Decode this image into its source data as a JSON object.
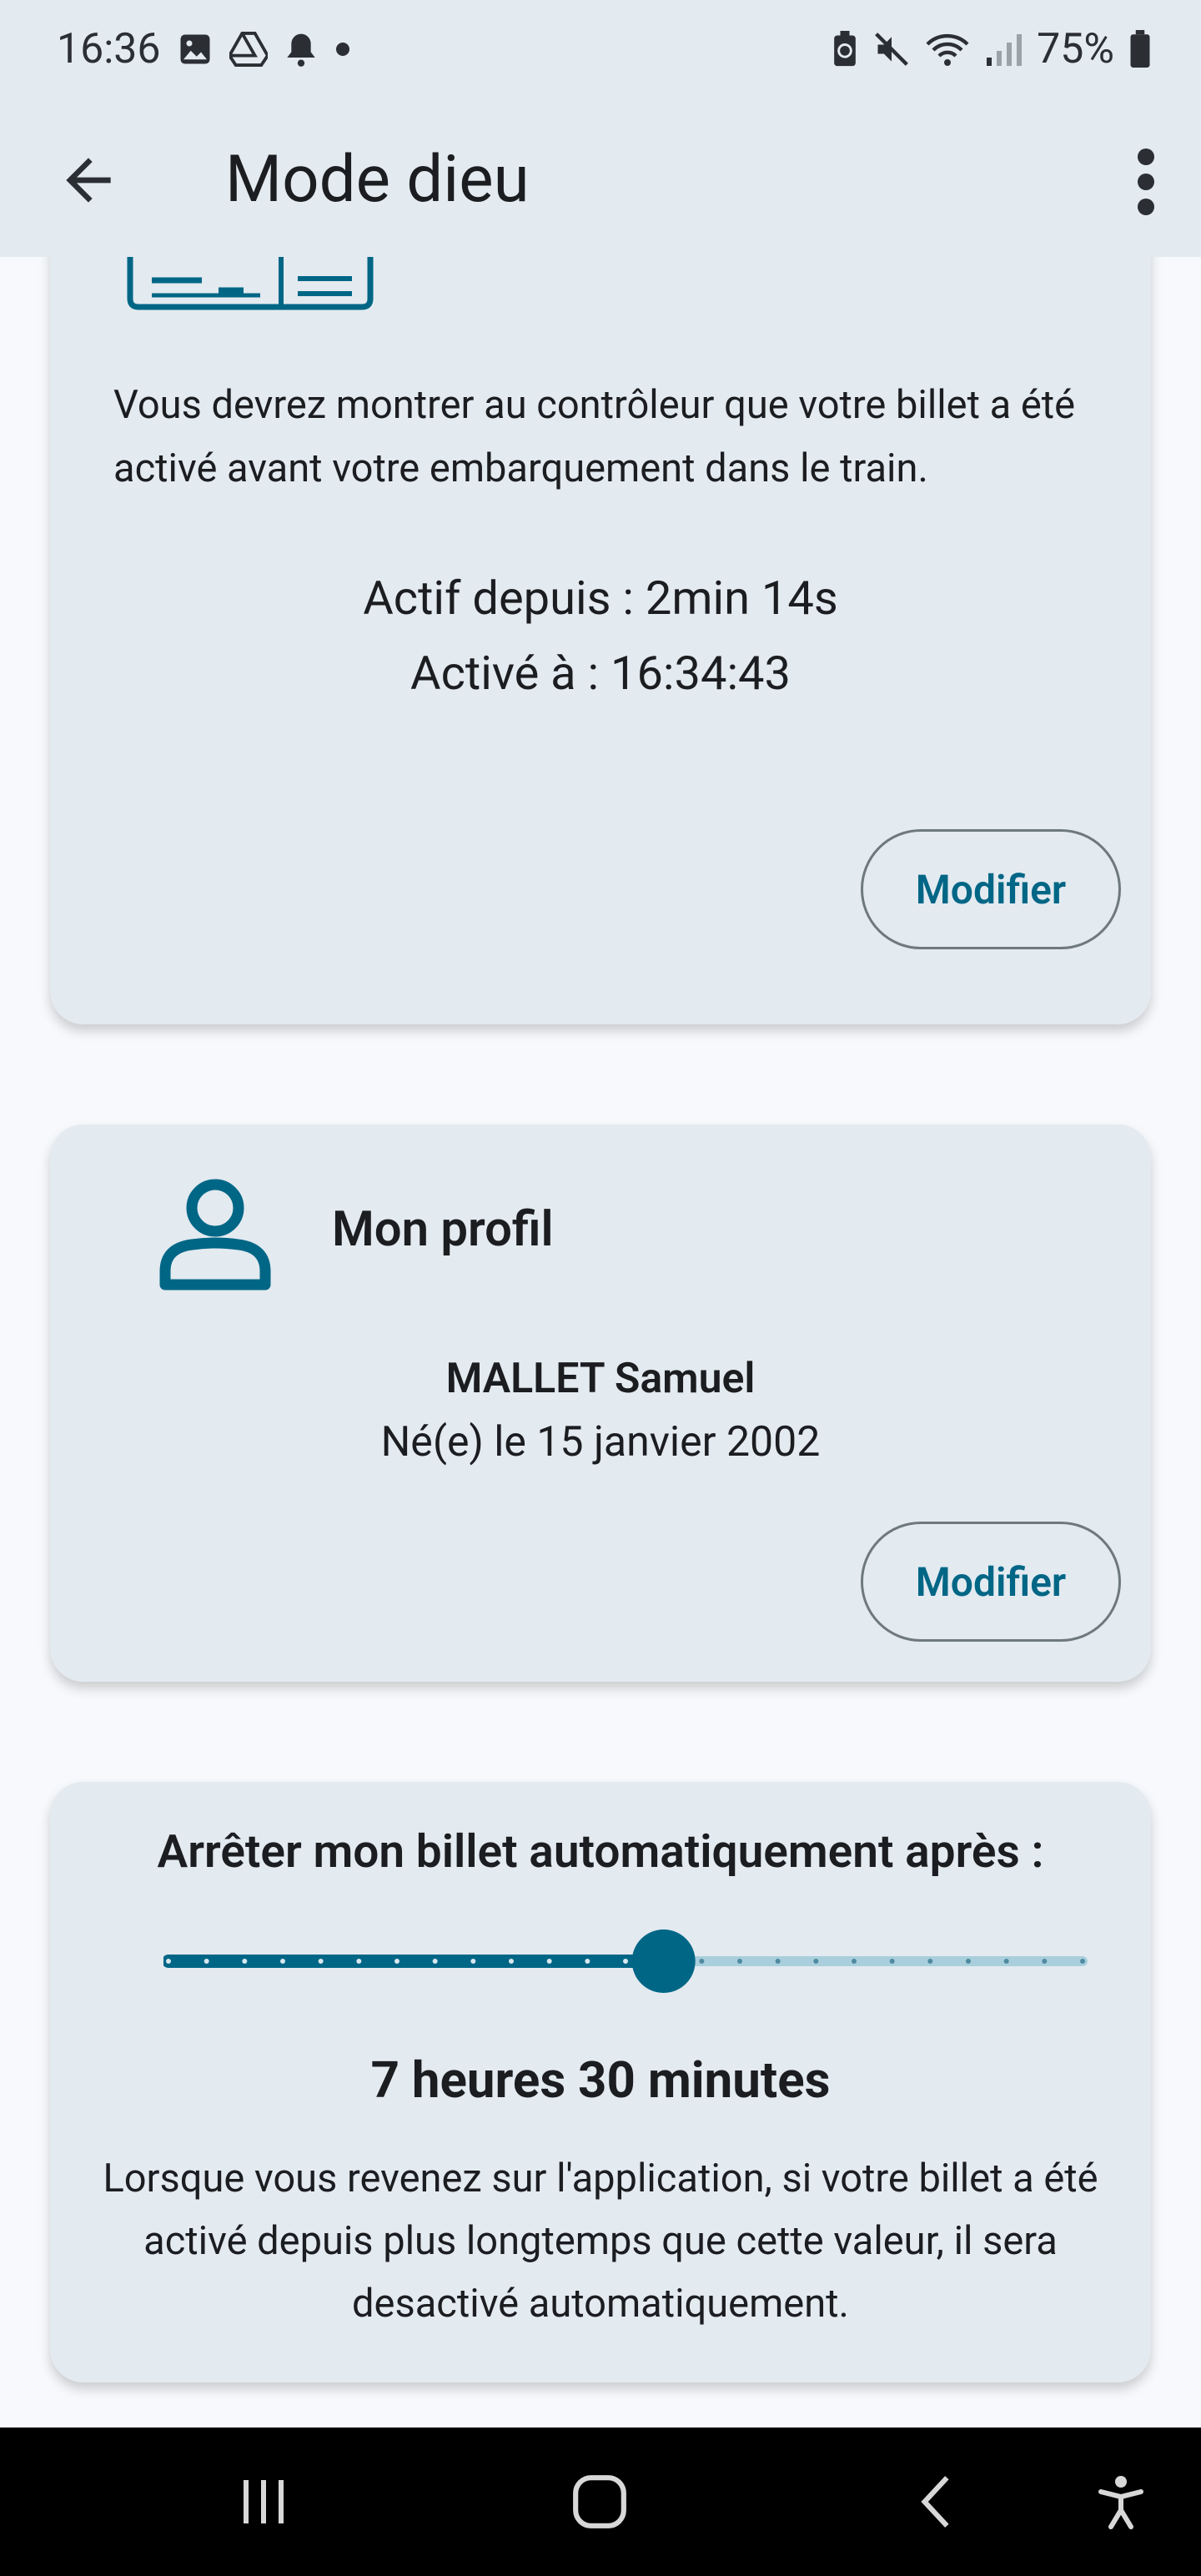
{
  "status_bar": {
    "time": "16:36",
    "battery": "75%",
    "left_icons": [
      "image-icon",
      "drive-icon",
      "bell-icon",
      "dot-icon"
    ],
    "right_icons": [
      "battery-saver-icon",
      "mute-icon",
      "wifi-icon",
      "signal-icon",
      "battery-icon"
    ]
  },
  "app_bar": {
    "title": "Mode dieu",
    "back_icon": "arrow-back-icon",
    "menu_icon": "more-vert-icon"
  },
  "ticket_card": {
    "info": "Vous devrez montrer au contrôleur que votre billet a été activé avant votre embarquement dans le train.",
    "active_since": "Actif depuis :  2min 14s",
    "activated_at": "Activé à : 16:34:43",
    "button": "Modifier"
  },
  "profile_card": {
    "title": "Mon profil",
    "name": "MALLET Samuel",
    "birth": "Né(e) le 15 janvier 2002",
    "button": "Modifier"
  },
  "auto_stop_card": {
    "title": "Arrêter mon billet automatiquement après :",
    "duration": "7 heures 30 minutes",
    "slider_steps": 24,
    "slider_value_step": 13,
    "description": "Lorsque vous revenez sur l'application, si votre billet a été activé depuis plus longtemps que cette valeur, il sera desactivé automatiquement."
  },
  "colors": {
    "accent": "#006686",
    "surface": "#e3eaf0",
    "background": "#f7f9fc",
    "track_inactive": "#a9cfdc"
  },
  "nav_bar": {
    "items": [
      "recents-icon",
      "home-icon",
      "back-icon",
      "accessibility-icon"
    ]
  }
}
